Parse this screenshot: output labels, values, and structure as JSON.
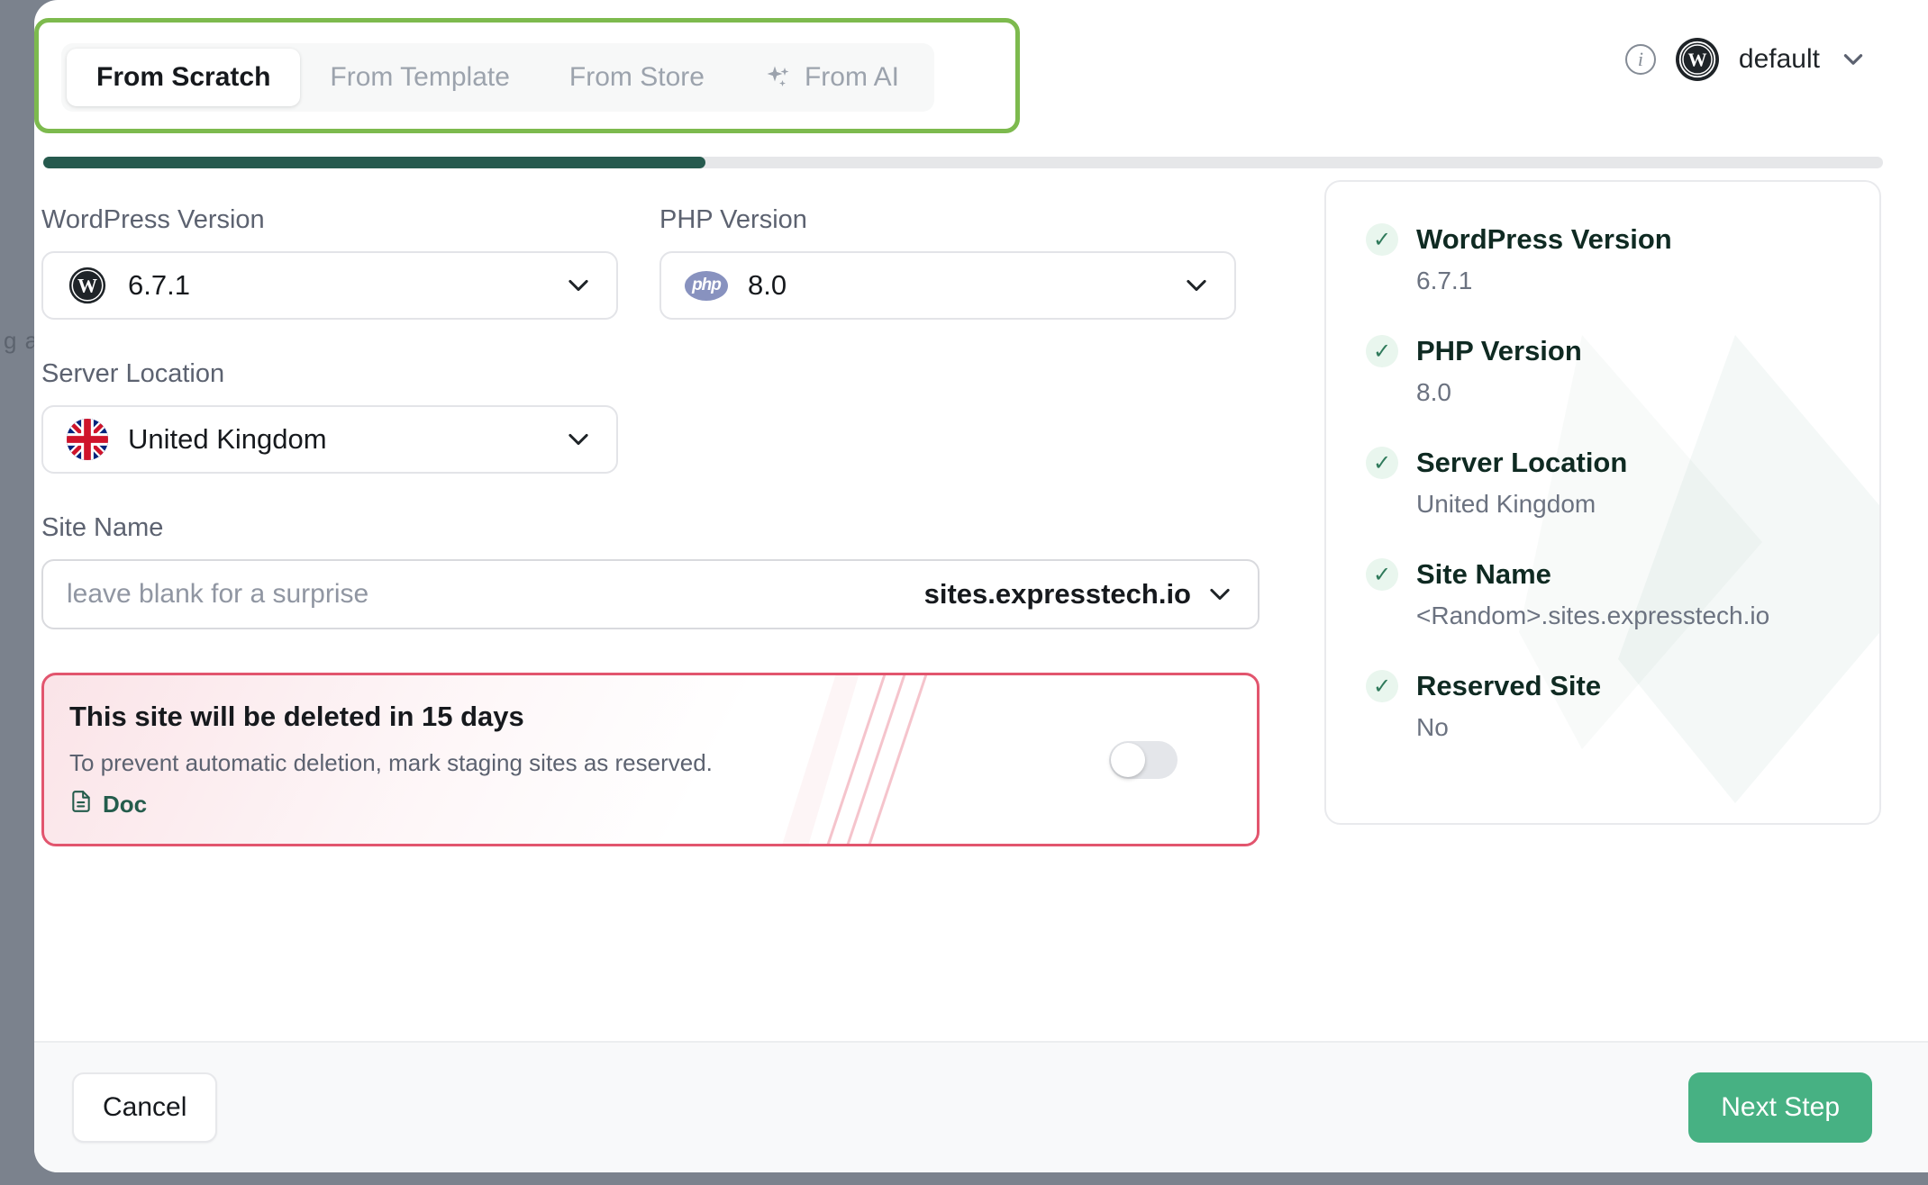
{
  "backdrop": {
    "bleed_text": "g a e - o"
  },
  "header": {
    "tabs": [
      {
        "label": "From Scratch",
        "active": true,
        "icon": null
      },
      {
        "label": "From Template",
        "active": false,
        "icon": null
      },
      {
        "label": "From Store",
        "active": false,
        "icon": null
      },
      {
        "label": "From AI",
        "active": false,
        "icon": "sparkles-icon"
      }
    ],
    "info_icon": "info-icon",
    "account": {
      "avatar_icon": "wordpress-icon",
      "name": "default",
      "caret_icon": "chevron-down-icon"
    }
  },
  "progress": {
    "percent": 36
  },
  "form": {
    "wordpress_version": {
      "label": "WordPress Version",
      "value": "6.7.1",
      "icon": "wordpress-icon",
      "caret_icon": "chevron-down-icon"
    },
    "php_version": {
      "label": "PHP Version",
      "value": "8.0",
      "icon": "php-icon",
      "caret_icon": "chevron-down-icon"
    },
    "server_location": {
      "label": "Server Location",
      "value": "United Kingdom",
      "icon": "uk-flag-icon",
      "caret_icon": "chevron-down-icon"
    },
    "site_name": {
      "label": "Site Name",
      "value": "",
      "placeholder": "leave blank for a surprise",
      "domain_suffix": "sites.expresstech.io",
      "caret_icon": "chevron-down-icon"
    }
  },
  "warning": {
    "title": "This site will be deleted in 15 days",
    "subtitle": "To prevent automatic deletion, mark staging sites as reserved.",
    "doc_link": "Doc",
    "doc_icon": "document-icon",
    "toggle_on": false,
    "border_color": "#e2556e"
  },
  "summary": {
    "items": [
      {
        "label": "WordPress Version",
        "value": "6.7.1",
        "check_icon": "check-icon"
      },
      {
        "label": "PHP Version",
        "value": "8.0",
        "check_icon": "check-icon"
      },
      {
        "label": "Server Location",
        "value": "United Kingdom",
        "check_icon": "check-icon"
      },
      {
        "label": "Site Name",
        "value": "<Random>.sites.expresstech.io",
        "check_icon": "check-icon"
      },
      {
        "label": "Reserved Site",
        "value": "No",
        "check_icon": "check-icon"
      }
    ]
  },
  "footer": {
    "cancel_label": "Cancel",
    "next_label": "Next Step"
  },
  "colors": {
    "highlight_green": "#7dba4e",
    "progress_green": "#265a4e",
    "primary_green": "#47b183",
    "warning_red": "#e2556e",
    "doc_green": "#245c4c",
    "check_green": "#2f7a5b"
  }
}
